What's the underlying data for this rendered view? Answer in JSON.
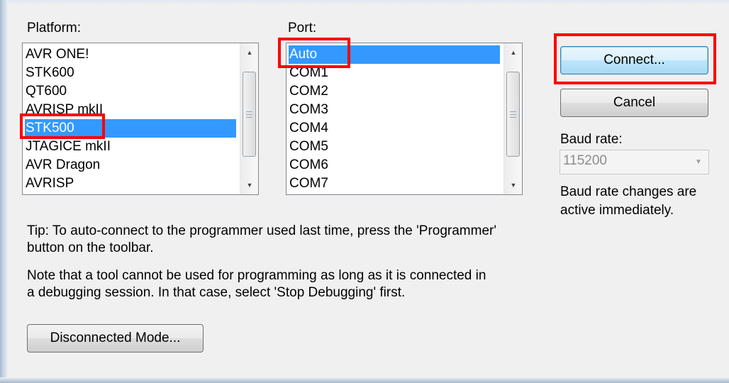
{
  "platform": {
    "label": "Platform:",
    "items": [
      "AVR ONE!",
      "STK600",
      "QT600",
      "AVRISP mkII",
      "STK500",
      "JTAGICE mkII",
      "AVR Dragon",
      "AVRISP"
    ],
    "selected": "STK500"
  },
  "port": {
    "label": "Port:",
    "items": [
      "Auto",
      "COM1",
      "COM2",
      "COM3",
      "COM4",
      "COM5",
      "COM6",
      "COM7"
    ],
    "selected": "Auto"
  },
  "buttons": {
    "connect": "Connect...",
    "cancel": "Cancel",
    "disconnected_mode": "Disconnected Mode..."
  },
  "baud": {
    "label": "Baud rate:",
    "value": "115200",
    "note_line1": "Baud rate changes are",
    "note_line2": "active immediately."
  },
  "tip": {
    "line1": "Tip: To auto-connect to the programmer used last time, press the 'Programmer'",
    "line2": "button on the toolbar."
  },
  "note": {
    "line1": "Note that a tool cannot be used for programming as long as it is connected in",
    "line2": "a debugging session. In that case, select 'Stop Debugging' first."
  },
  "colors": {
    "selection": "#3399ff",
    "highlight": "#ff0000",
    "dialog_bg": "#f0f0f0"
  }
}
